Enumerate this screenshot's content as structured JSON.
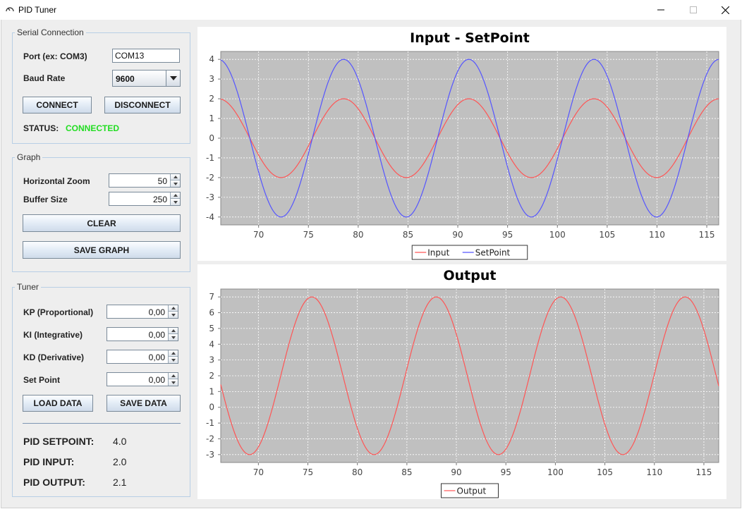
{
  "window": {
    "title": "PID Tuner"
  },
  "serial": {
    "group_title": "Serial Connection",
    "port_label": "Port (ex: COM3)",
    "port_value": "COM13",
    "baud_label": "Baud Rate",
    "baud_value": "9600",
    "connect_label": "CONNECT",
    "disconnect_label": "DISCONNECT",
    "status_label": "STATUS:",
    "status_value": "CONNECTED",
    "status_color": "#22dd22"
  },
  "graph": {
    "group_title": "Graph",
    "hzoom_label": "Horizontal Zoom",
    "hzoom_value": "50",
    "buffer_label": "Buffer Size",
    "buffer_value": "250",
    "clear_label": "CLEAR",
    "save_label": "SAVE GRAPH"
  },
  "tuner": {
    "group_title": "Tuner",
    "kp_label": "KP (Proportional)",
    "kp_value": "0,00",
    "ki_label": "KI (Integrative)",
    "ki_value": "0,00",
    "kd_label": "KD (Derivative)",
    "kd_value": "0,00",
    "sp_label": "Set Point",
    "sp_value": "0,00",
    "load_label": "LOAD DATA",
    "save_label": "SAVE DATA",
    "pid_setpoint_label": "PID SETPOINT:",
    "pid_setpoint_value": "4.0",
    "pid_input_label": "PID INPUT:",
    "pid_input_value": "2.0",
    "pid_output_label": "PID OUTPUT:",
    "pid_output_value": "2.1"
  },
  "chart_data": [
    {
      "type": "line",
      "title": "Input - SetPoint",
      "xlabel": "",
      "ylabel": "",
      "xlim": [
        66.2,
        116.2
      ],
      "ylim": [
        -4.4,
        4.4
      ],
      "xticks": [
        70,
        75,
        80,
        85,
        90,
        95,
        100,
        105,
        110,
        115
      ],
      "yticks": [
        -4,
        -3,
        -2,
        -1,
        0,
        1,
        2,
        3,
        4
      ],
      "grid": true,
      "legend": "bottom-center",
      "series": [
        {
          "name": "Input",
          "color": "#ff5555",
          "x_range": [
            66.2,
            116.2
          ],
          "period": 12.566,
          "amplitude": 2,
          "phase_x_at_max": 78.54
        },
        {
          "name": "SetPoint",
          "color": "#5555ff",
          "x_range": [
            66.2,
            116.2
          ],
          "period": 12.566,
          "amplitude": 4,
          "phase_x_at_max": 78.54
        }
      ]
    },
    {
      "type": "line",
      "title": "Output",
      "xlabel": "",
      "ylabel": "",
      "xlim": [
        66.2,
        116.5
      ],
      "ylim": [
        -3.5,
        7.5
      ],
      "xticks": [
        70,
        75,
        80,
        85,
        90,
        95,
        100,
        105,
        110,
        115
      ],
      "yticks": [
        -3,
        -2,
        -1,
        0,
        1,
        2,
        3,
        4,
        5,
        6,
        7
      ],
      "grid": true,
      "legend": "bottom-center",
      "series": [
        {
          "name": "Output",
          "color": "#ff5555",
          "x_range": [
            66.2,
            116.5
          ],
          "period": 12.566,
          "amplitude": 5,
          "offset": 2,
          "phase_x_at_max": 75.4
        }
      ]
    }
  ]
}
